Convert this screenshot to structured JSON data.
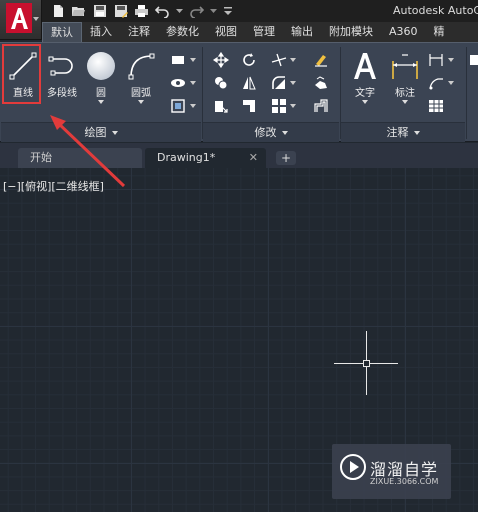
{
  "title_bar": {
    "app_title": "Autodesk AutoC"
  },
  "ribbon_tabs": [
    "默认",
    "插入",
    "注释",
    "参数化",
    "视图",
    "管理",
    "输出",
    "附加模块",
    "A360",
    "精"
  ],
  "draw_panel": {
    "title": "绘图",
    "tools": {
      "line": "直线",
      "polyline": "多段线",
      "circle": "圆",
      "arc": "圆弧"
    }
  },
  "modify_panel": {
    "title": "修改"
  },
  "annotation_panel": {
    "title": "注释",
    "tools": {
      "text": "文字",
      "dimension": "标注"
    }
  },
  "file_tabs": {
    "start": "开始",
    "drawing": "Drawing1*",
    "close": "✕",
    "add": "+"
  },
  "viewport_label": "[−][俯视][二维线框]",
  "watermark": {
    "title": "溜溜自学",
    "subtitle": "ZIXUE.3066.COM"
  },
  "colors": {
    "accent_red": "#e23b3b",
    "ribbon": "#3b4453",
    "canvas": "#212830"
  }
}
